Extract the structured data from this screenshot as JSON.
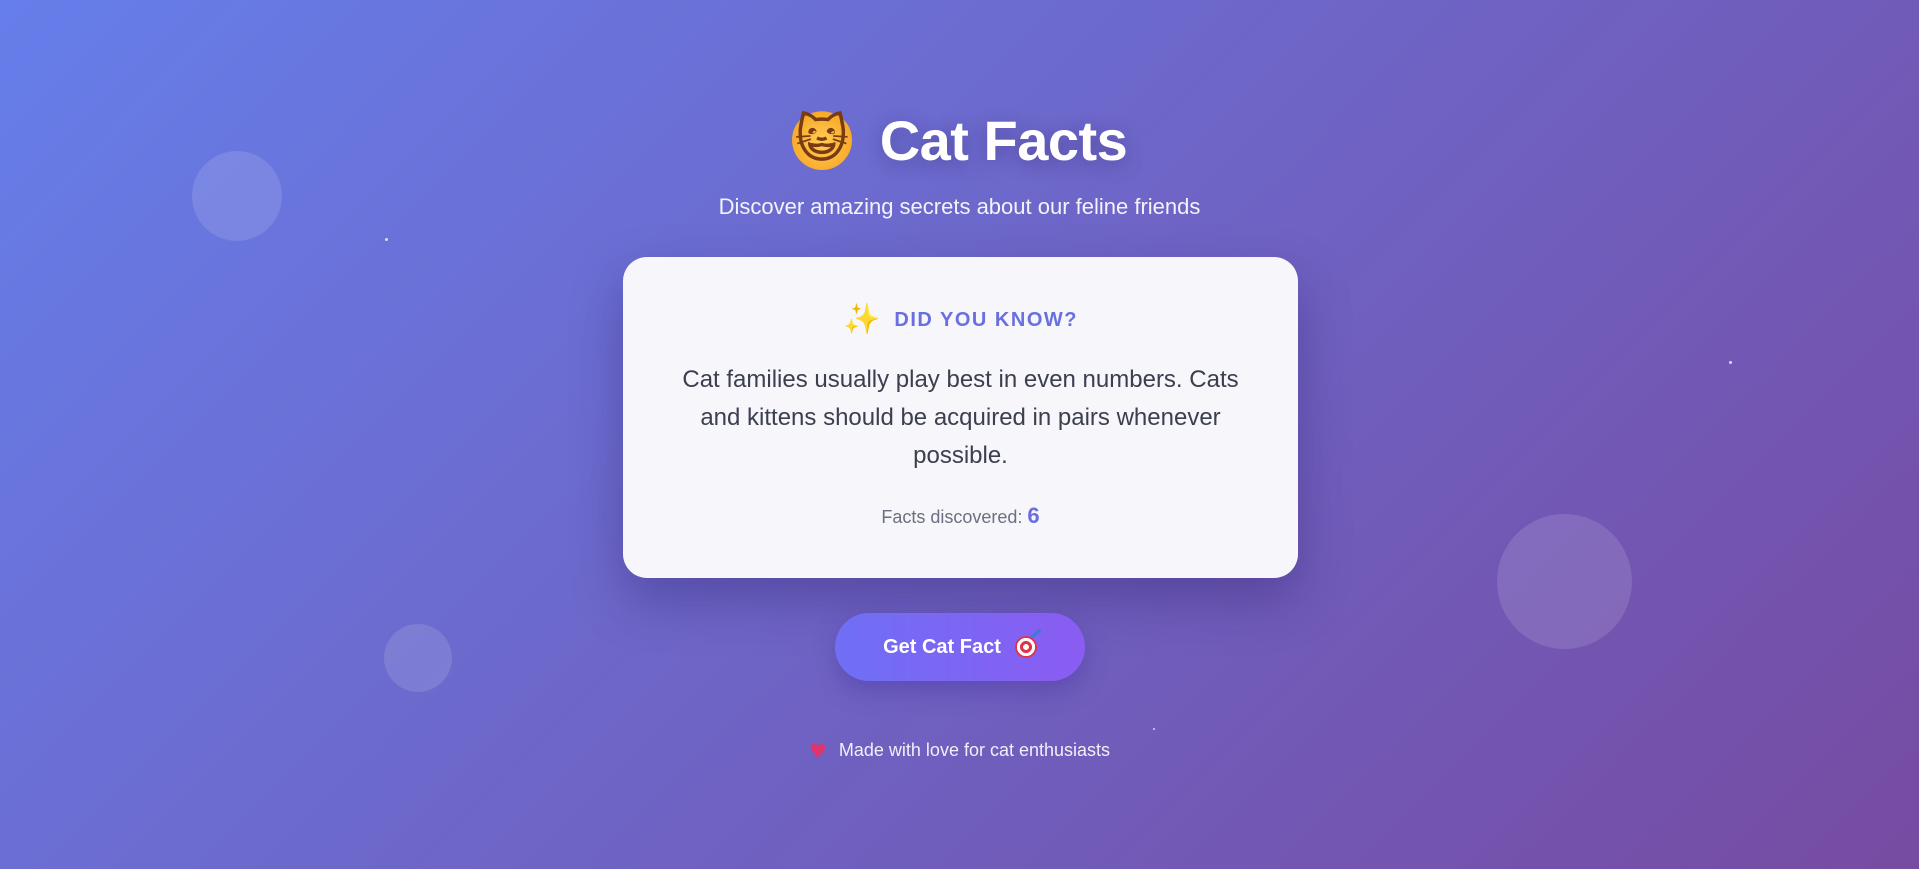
{
  "header": {
    "icon": "cat-face-icon",
    "icon_glyph": "😺",
    "title": "Cat Facts",
    "subtitle": "Discover amazing secrets about our feline friends"
  },
  "card": {
    "heading_icon": "sparkles-icon",
    "heading_icon_glyph": "✨",
    "heading": "DID YOU KNOW?",
    "fact": "Cat families usually play best in even numbers. Cats and kittens should be acquired in pairs whenever possible.",
    "counter_label": "Facts discovered:",
    "counter_value": "6"
  },
  "button": {
    "label": "Get Cat Fact",
    "icon": "target-icon"
  },
  "footer": {
    "icon": "heart-icon",
    "icon_glyph": "♥",
    "text": "Made with love for cat enthusiasts"
  },
  "colors": {
    "background_start": "#667eea",
    "background_end": "#764ba2",
    "accent": "#6a6fe0",
    "card_background": "#f6f6fb",
    "button_start": "#6f6ff5",
    "button_end": "#8a5cf2"
  }
}
